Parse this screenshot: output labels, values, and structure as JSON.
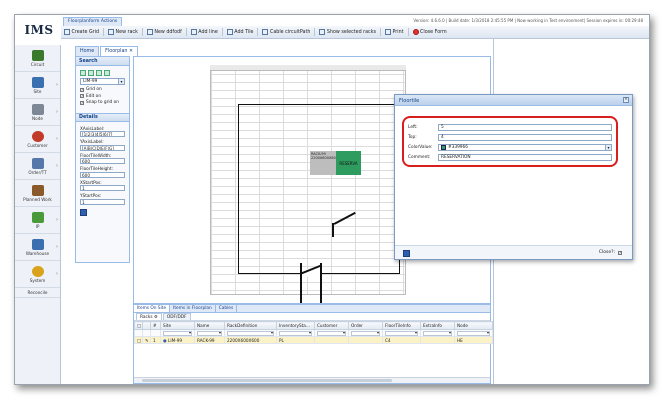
{
  "app": {
    "logo": "IMS",
    "version_info": "Version: 4.6.6.0 | Build date: 1/3/2018 2:45:55 PM | Now working in Test environment| Session expires in: 00:29:48",
    "actions_tab": "Floorplanform Actions"
  },
  "toolbar": [
    {
      "label": "Create Grid",
      "icon": "grid-icon"
    },
    {
      "label": "New rack",
      "icon": "rack-icon"
    },
    {
      "label": "New ddfodf",
      "icon": "ddf-icon"
    },
    {
      "label": "Add line",
      "icon": "line-icon"
    },
    {
      "label": "Add Tile",
      "icon": "tile-icon"
    },
    {
      "label": "Cable circuitPath",
      "icon": "cable-icon"
    },
    {
      "label": "Show selected racks",
      "icon": "racks-icon"
    },
    {
      "label": "Print",
      "icon": "print-icon"
    },
    {
      "label": "Close Form",
      "icon": "close-form-icon"
    }
  ],
  "nav": [
    {
      "label": "Circuit",
      "color": "#3b7a2c"
    },
    {
      "label": "Site",
      "color": "#3a6fb0"
    },
    {
      "label": "Node",
      "color": "#7d8796"
    },
    {
      "label": "Customer",
      "color": "#c23a2a"
    },
    {
      "label": "Order/TT",
      "color": "#5577aa"
    },
    {
      "label": "Planned Work",
      "color": "#8a5a2a"
    },
    {
      "label": "IP",
      "color": "#4a9a3a"
    },
    {
      "label": "Warehouse",
      "color": "#3a6fb0"
    },
    {
      "label": "System",
      "color": "#d9a21b"
    },
    {
      "label": "Reconcile",
      "color": ""
    }
  ],
  "tabs": [
    {
      "label": "Home"
    },
    {
      "label": "Floorplan"
    }
  ],
  "search_panel": {
    "title": "Search",
    "site_value": "LIM-99",
    "checks": [
      {
        "label": "Grid on"
      },
      {
        "label": "Edit on"
      },
      {
        "label": "Snap to grid on"
      }
    ]
  },
  "details_panel": {
    "title": "Details",
    "fields": [
      {
        "label": "XAxisLabel:",
        "value": "[1|2|3|4|5|6|7]"
      },
      {
        "label": "YAxisLabel:",
        "value": "[A|B|C|D|E|F|G]"
      },
      {
        "label": "FloorTileWidth:",
        "value": "600"
      },
      {
        "label": "FloorTileHeight:",
        "value": "600"
      },
      {
        "label": "XStartPos:",
        "value": "1"
      },
      {
        "label": "YStartPos:",
        "value": "1"
      }
    ]
  },
  "canvas": {
    "rack_label": "RACK-99 2200X600X600",
    "reserve_label": "RESERVA"
  },
  "dialog": {
    "title": "Floortile",
    "fields": [
      {
        "label": "Left:",
        "value": "5"
      },
      {
        "label": "Top:",
        "value": "4"
      },
      {
        "label": "ColorValue:",
        "value": "#339966"
      },
      {
        "label": "Comment:",
        "value": "RESERVATION"
      }
    ],
    "close_label": "Close?:"
  },
  "bottom": {
    "tabs": [
      "Items On Site",
      "Items in Floorplan",
      "Cables"
    ],
    "subtabs": [
      "Racks",
      "ODF/DDF"
    ],
    "columns": [
      "#",
      "Site",
      "Name",
      "RackDefinition",
      "InventorySta...",
      "Customer",
      "Order",
      "FloorTileInfo",
      "ExtraInfo",
      "Node"
    ],
    "rows": [
      [
        "1",
        "LIM-99",
        "RACK-99",
        "2200X600X600",
        "PL",
        "",
        "",
        "C4",
        "",
        "HE"
      ]
    ]
  },
  "colors": {
    "accent": "#15428b",
    "highlight": "#d91e1e",
    "tile": "#339966"
  }
}
